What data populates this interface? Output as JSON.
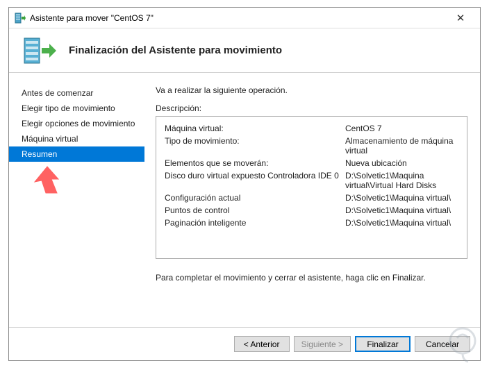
{
  "titlebar": {
    "text": "Asistente para mover \"CentOS 7\""
  },
  "header": {
    "title": "Finalización del Asistente para movimiento"
  },
  "sidebar": {
    "items": [
      {
        "label": "Antes de comenzar"
      },
      {
        "label": "Elegir tipo de movimiento"
      },
      {
        "label": "Elegir opciones de movimiento"
      },
      {
        "label": "Máquina virtual"
      },
      {
        "label": "Resumen"
      }
    ],
    "selected_index": 4
  },
  "content": {
    "intro": "Va a realizar la siguiente operación.",
    "desc_label": "Descripción:",
    "details": [
      {
        "key": "Máquina virtual:",
        "val": "CentOS 7"
      },
      {
        "key": "Tipo de movimiento:",
        "val": "Almacenamiento de máquina virtual"
      },
      {
        "key": "Elementos que se moverán:",
        "val": "Nueva ubicación"
      },
      {
        "key": "Disco duro virtual expuesto  Controladora IDE 0",
        "val": "D:\\Solvetic1\\Maquina virtual\\Virtual Hard Disks"
      },
      {
        "key": "Configuración actual",
        "val": "D:\\Solvetic1\\Maquina virtual\\"
      },
      {
        "key": "Puntos de control",
        "val": "D:\\Solvetic1\\Maquina virtual\\"
      },
      {
        "key": "Paginación inteligente",
        "val": "D:\\Solvetic1\\Maquina virtual\\"
      }
    ],
    "completion": "Para completar el movimiento y cerrar el asistente, haga clic en Finalizar."
  },
  "footer": {
    "back": "< Anterior",
    "next": "Siguiente >",
    "finish": "Finalizar",
    "cancel": "Cancelar"
  }
}
